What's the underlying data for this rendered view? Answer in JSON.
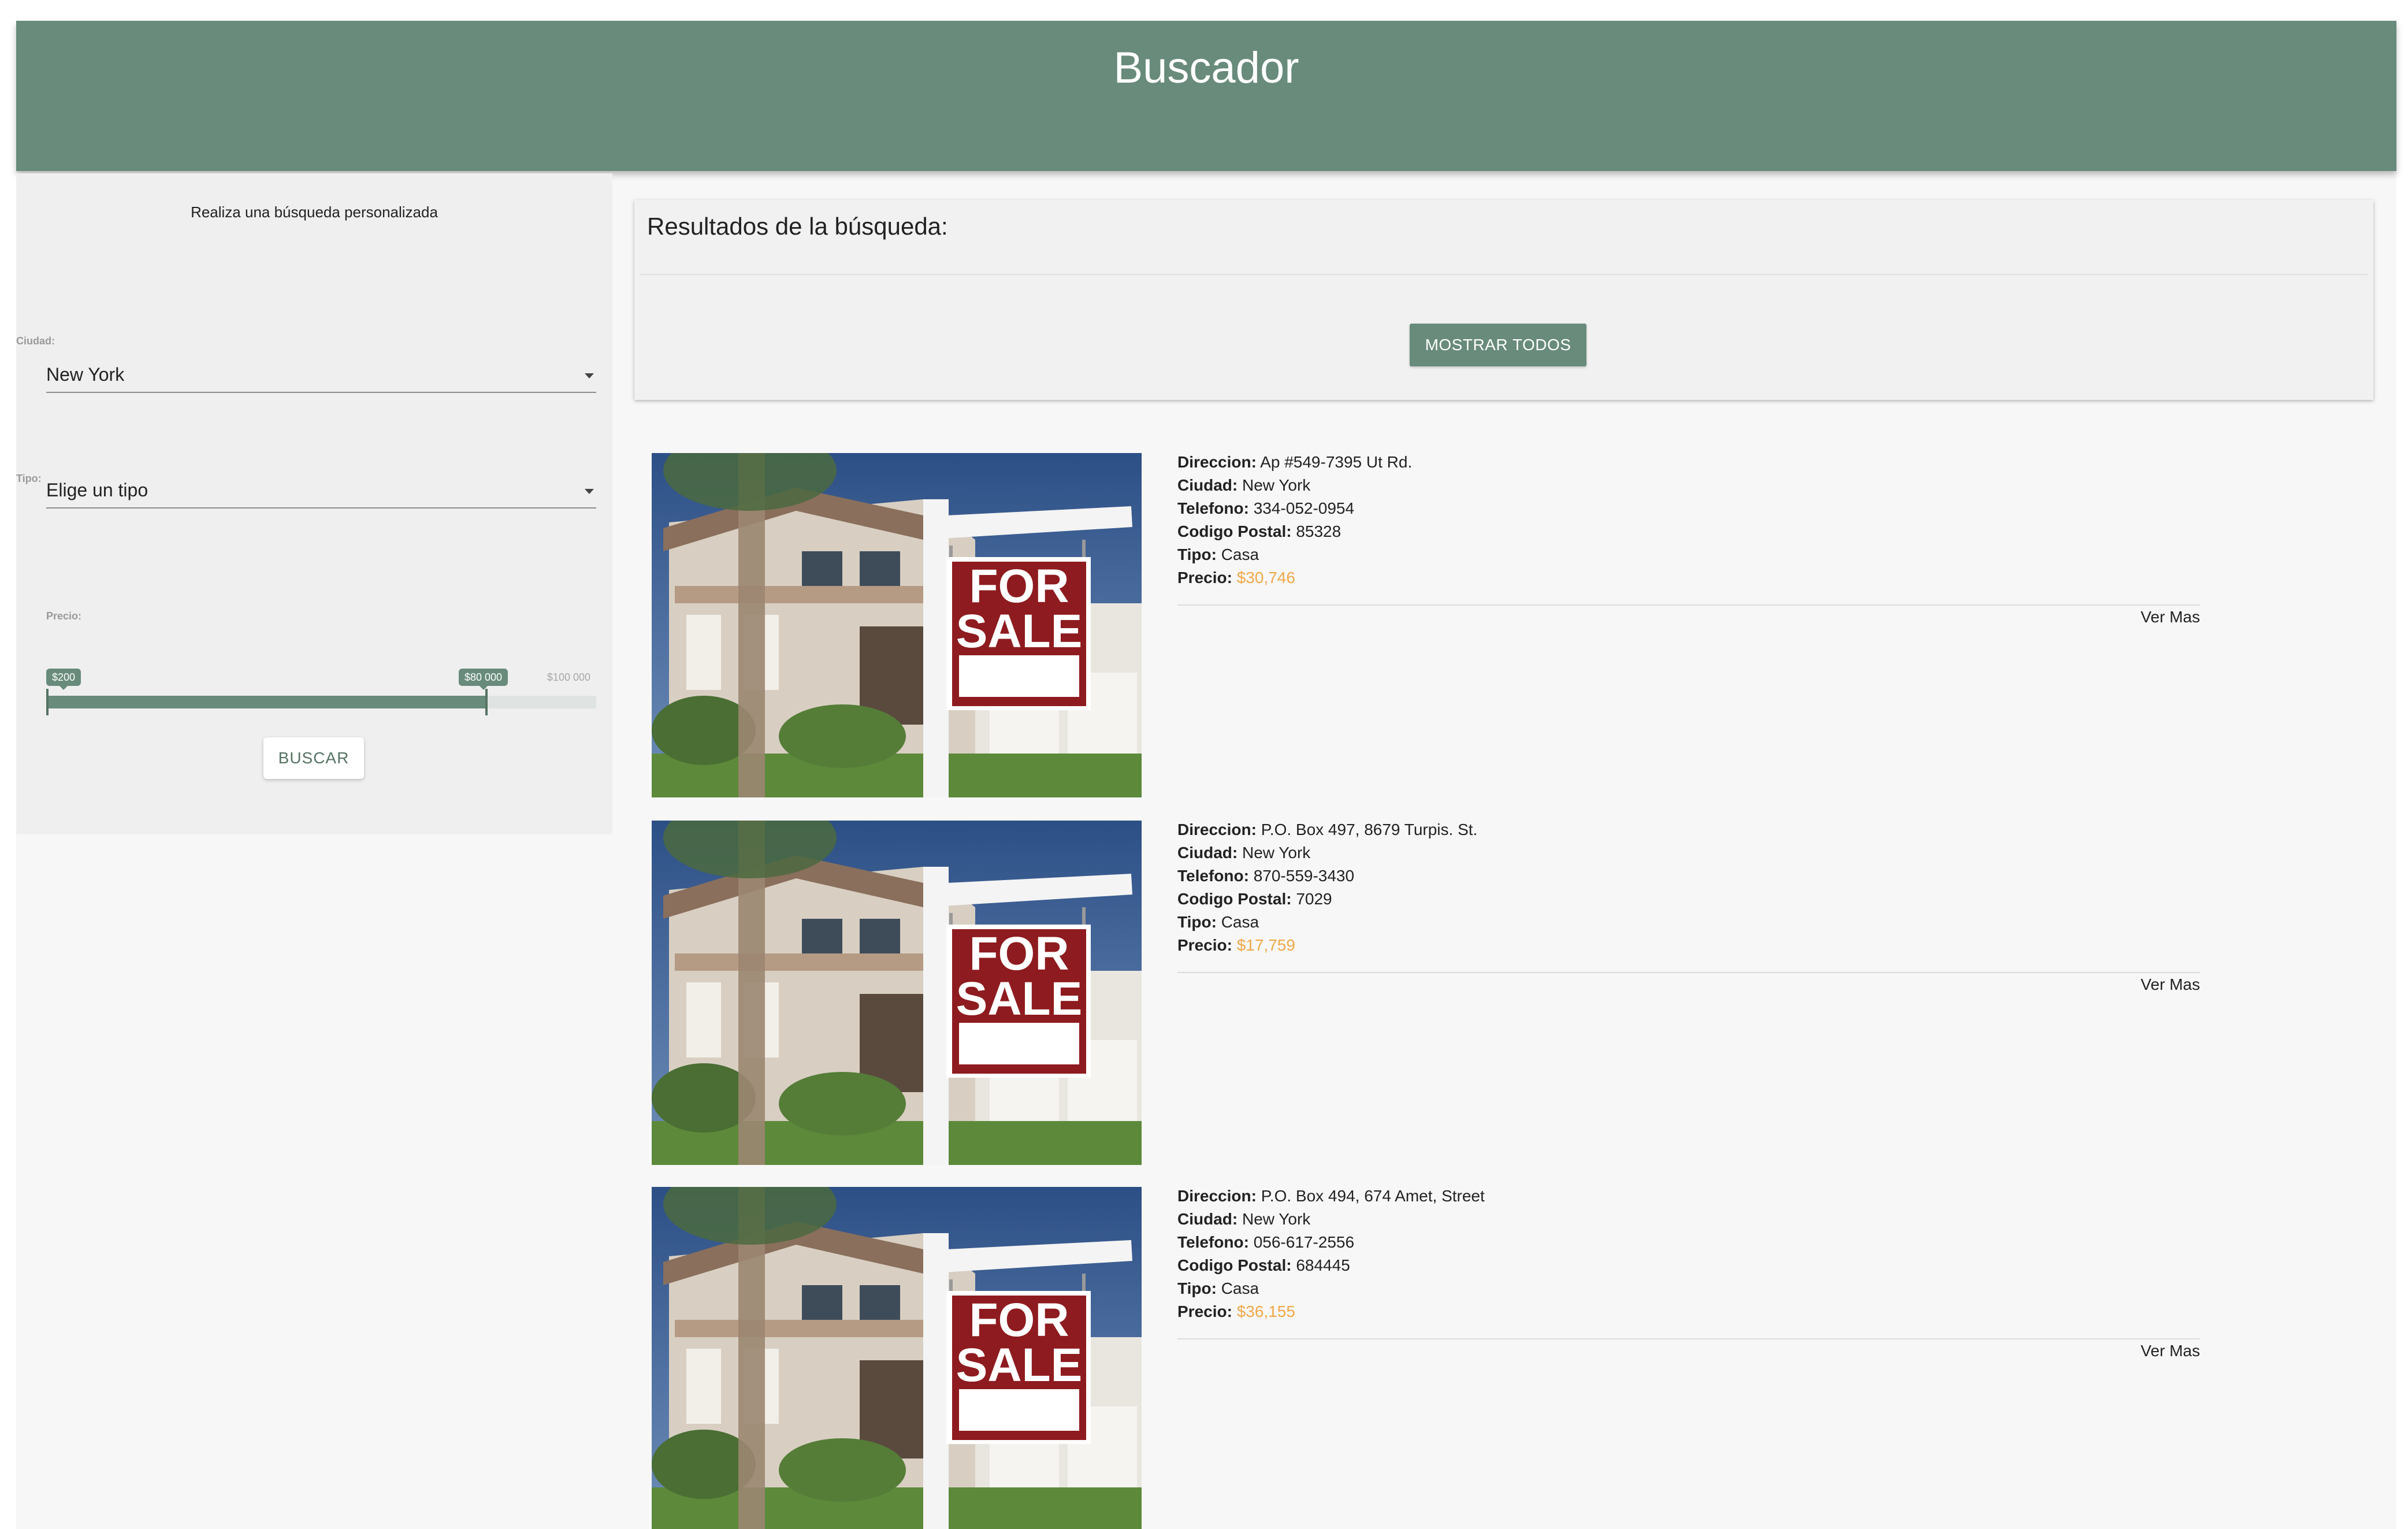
{
  "header": {
    "title": "Buscador"
  },
  "sidebar": {
    "title": "Realiza una búsqueda personalizada",
    "city": {
      "label": "Ciudad:",
      "value": "New York"
    },
    "type": {
      "label": "Tipo:",
      "value": "Elige un tipo"
    },
    "price": {
      "label": "Precio:",
      "min_label": "$200",
      "max_label": "$80 000",
      "limit_label": "$100 000",
      "range_min": 0,
      "range_max": 100000,
      "from": 200,
      "to": 80000
    },
    "search_button": "BUSCAR"
  },
  "results": {
    "title": "Resultados de la búsqueda:",
    "show_all_button": "MOSTRAR TODOS",
    "labels": {
      "address": "Direccion:",
      "city": "Ciudad:",
      "phone": "Telefono:",
      "postal": "Codigo Postal:",
      "type": "Tipo:",
      "price": "Precio:",
      "more": "Ver Mas"
    },
    "items": [
      {
        "address": "Ap #549-7395 Ut Rd.",
        "city": "New York",
        "phone": "334-052-0954",
        "postal": "85328",
        "type": "Casa",
        "price": "$30,746"
      },
      {
        "address": "P.O. Box 497, 8679 Turpis. St.",
        "city": "New York",
        "phone": "870-559-3430",
        "postal": "7029",
        "type": "Casa",
        "price": "$17,759"
      },
      {
        "address": "P.O. Box 494, 674 Amet, Street",
        "city": "New York",
        "phone": "056-617-2556",
        "postal": "684445",
        "type": "Casa",
        "price": "$36,155"
      }
    ],
    "photo_sign": [
      "FOR",
      "SALE"
    ]
  },
  "colors": {
    "primary": "#688b7b",
    "price": "#f0a848",
    "background": "#f7f7f7"
  }
}
